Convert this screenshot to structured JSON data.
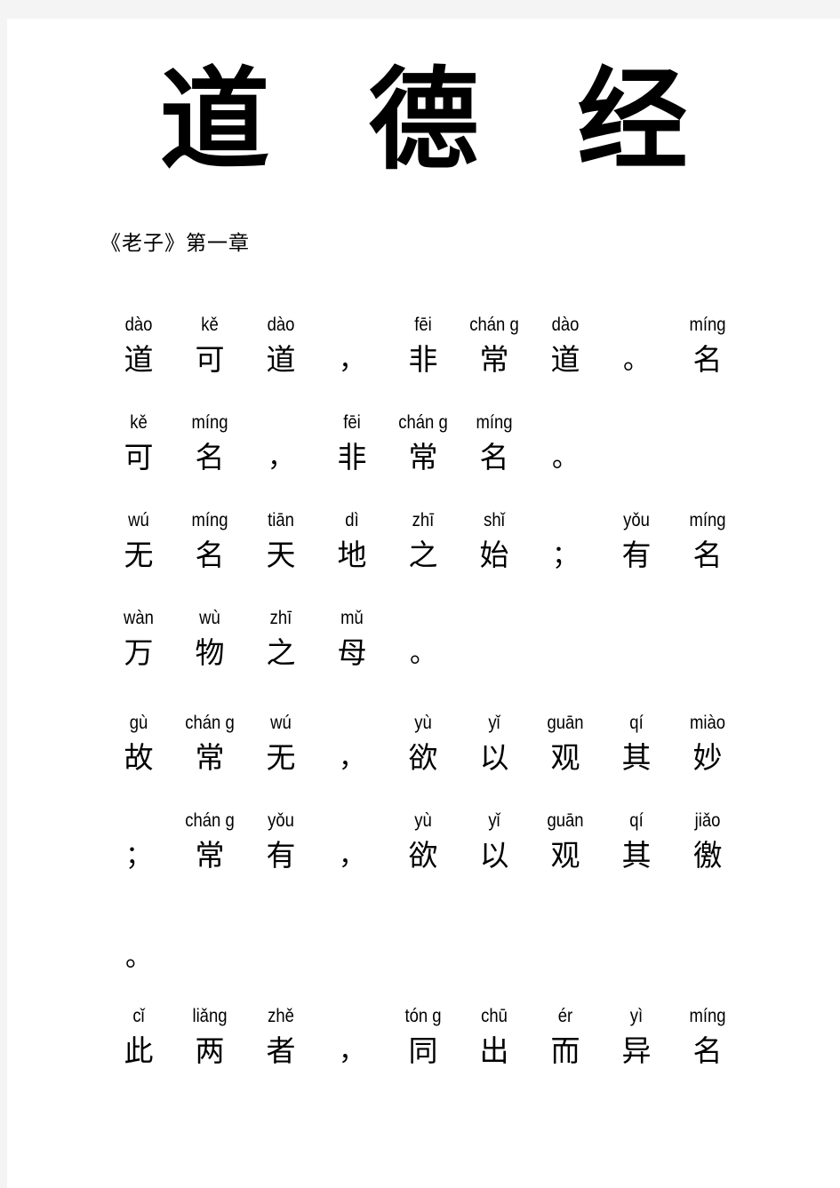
{
  "document": {
    "title": "道 德 经",
    "subtitle": "《老子》第一章",
    "page_background": "#ffffff",
    "canvas_background": "#f4f4f4",
    "text_color": "#000000"
  },
  "verses": [
    {
      "id": "line-1",
      "cells": [
        {
          "pinyin": "dào",
          "hanzi": "道"
        },
        {
          "pinyin": "kě",
          "hanzi": "可"
        },
        {
          "pinyin": "dào",
          "hanzi": "道"
        },
        {
          "pinyin": "",
          "hanzi": "，"
        },
        {
          "pinyin": "fēi",
          "hanzi": "非"
        },
        {
          "pinyin": "chán g",
          "hanzi": "常"
        },
        {
          "pinyin": "dào",
          "hanzi": "道"
        },
        {
          "pinyin": "",
          "hanzi": "。"
        },
        {
          "pinyin": "míng",
          "hanzi": "名"
        }
      ]
    },
    {
      "id": "line-2",
      "cells": [
        {
          "pinyin": "kě",
          "hanzi": "可"
        },
        {
          "pinyin": "míng",
          "hanzi": "名"
        },
        {
          "pinyin": "",
          "hanzi": "，"
        },
        {
          "pinyin": "fēi",
          "hanzi": "非"
        },
        {
          "pinyin": "chán g",
          "hanzi": "常"
        },
        {
          "pinyin": "míng",
          "hanzi": "名"
        },
        {
          "pinyin": "",
          "hanzi": "。"
        },
        {
          "pinyin": "",
          "hanzi": ""
        },
        {
          "pinyin": "",
          "hanzi": ""
        }
      ]
    },
    {
      "id": "line-3",
      "cells": [
        {
          "pinyin": "wú",
          "hanzi": "无"
        },
        {
          "pinyin": "míng",
          "hanzi": "名"
        },
        {
          "pinyin": "tiān",
          "hanzi": "天"
        },
        {
          "pinyin": "dì",
          "hanzi": "地"
        },
        {
          "pinyin": "zhī",
          "hanzi": "之"
        },
        {
          "pinyin": "shǐ",
          "hanzi": "始"
        },
        {
          "pinyin": "",
          "hanzi": "；"
        },
        {
          "pinyin": "yǒu",
          "hanzi": "有"
        },
        {
          "pinyin": "míng",
          "hanzi": "名"
        }
      ]
    },
    {
      "id": "line-4",
      "cells": [
        {
          "pinyin": "wàn",
          "hanzi": "万"
        },
        {
          "pinyin": "wù",
          "hanzi": "物"
        },
        {
          "pinyin": "zhī",
          "hanzi": "之"
        },
        {
          "pinyin": "mǔ",
          "hanzi": "母"
        },
        {
          "pinyin": "",
          "hanzi": "。"
        },
        {
          "pinyin": "",
          "hanzi": ""
        },
        {
          "pinyin": "",
          "hanzi": ""
        },
        {
          "pinyin": "",
          "hanzi": ""
        },
        {
          "pinyin": "",
          "hanzi": ""
        }
      ]
    },
    {
      "id": "line-5",
      "cells": [
        {
          "pinyin": "gù",
          "hanzi": "故"
        },
        {
          "pinyin": "chán g",
          "hanzi": "常"
        },
        {
          "pinyin": "wú",
          "hanzi": "无"
        },
        {
          "pinyin": "",
          "hanzi": "，"
        },
        {
          "pinyin": "yù",
          "hanzi": "欲"
        },
        {
          "pinyin": "yǐ",
          "hanzi": "以"
        },
        {
          "pinyin": "guān",
          "hanzi": "观"
        },
        {
          "pinyin": "qí",
          "hanzi": "其"
        },
        {
          "pinyin": "miào",
          "hanzi": "妙"
        }
      ]
    },
    {
      "id": "line-6",
      "cells": [
        {
          "pinyin": "",
          "hanzi": "；"
        },
        {
          "pinyin": "chán g",
          "hanzi": "常"
        },
        {
          "pinyin": "yǒu",
          "hanzi": "有"
        },
        {
          "pinyin": "",
          "hanzi": "，"
        },
        {
          "pinyin": "yù",
          "hanzi": "欲"
        },
        {
          "pinyin": "yǐ",
          "hanzi": "以"
        },
        {
          "pinyin": "guān",
          "hanzi": "观"
        },
        {
          "pinyin": "qí",
          "hanzi": "其"
        },
        {
          "pinyin": "jiǎo",
          "hanzi": "徼"
        }
      ]
    },
    {
      "id": "line-7",
      "cells": [
        {
          "pinyin": "",
          "hanzi": "。"
        },
        {
          "pinyin": "",
          "hanzi": ""
        },
        {
          "pinyin": "",
          "hanzi": ""
        },
        {
          "pinyin": "",
          "hanzi": ""
        },
        {
          "pinyin": "",
          "hanzi": ""
        },
        {
          "pinyin": "",
          "hanzi": ""
        },
        {
          "pinyin": "",
          "hanzi": ""
        },
        {
          "pinyin": "",
          "hanzi": ""
        },
        {
          "pinyin": "",
          "hanzi": ""
        }
      ]
    },
    {
      "id": "line-8",
      "cells": [
        {
          "pinyin": "cǐ",
          "hanzi": "此"
        },
        {
          "pinyin": "liǎng",
          "hanzi": "两"
        },
        {
          "pinyin": "zhě",
          "hanzi": "者"
        },
        {
          "pinyin": "",
          "hanzi": "，"
        },
        {
          "pinyin": "tón g",
          "hanzi": "同"
        },
        {
          "pinyin": "chū",
          "hanzi": "出"
        },
        {
          "pinyin": "ér",
          "hanzi": "而"
        },
        {
          "pinyin": "yì",
          "hanzi": "异"
        },
        {
          "pinyin": "míng",
          "hanzi": "名"
        }
      ]
    }
  ]
}
